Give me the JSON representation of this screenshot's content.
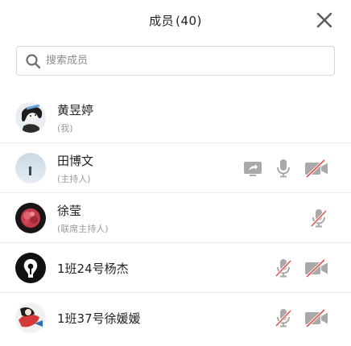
{
  "header": {
    "title": "成员",
    "count": "(40)"
  },
  "search": {
    "placeholder": "搜索成员",
    "value": ""
  },
  "members": [
    {
      "name": "黄昱婷",
      "role": "(我)"
    },
    {
      "name": "田博文",
      "role": "(主持人)"
    },
    {
      "name": "徐莹",
      "role": "(联席主持人)"
    },
    {
      "name": "1班24号杨杰",
      "role": ""
    },
    {
      "name": "1班37号徐媛媛",
      "role": ""
    }
  ],
  "icons": {
    "close": "close-icon",
    "search": "search-icon",
    "screen_share": "screen-share-icon",
    "mic_on": "microphone-icon",
    "mic_muted": "microphone-muted-icon",
    "camera_off": "camera-off-icon"
  },
  "colors": {
    "icon_gray": "#b4b4b4",
    "icon_dark": "#7a7a7a",
    "mute_red": "#e0524a",
    "divider": "#ececec",
    "secondary_text": "#9a9a9a"
  }
}
